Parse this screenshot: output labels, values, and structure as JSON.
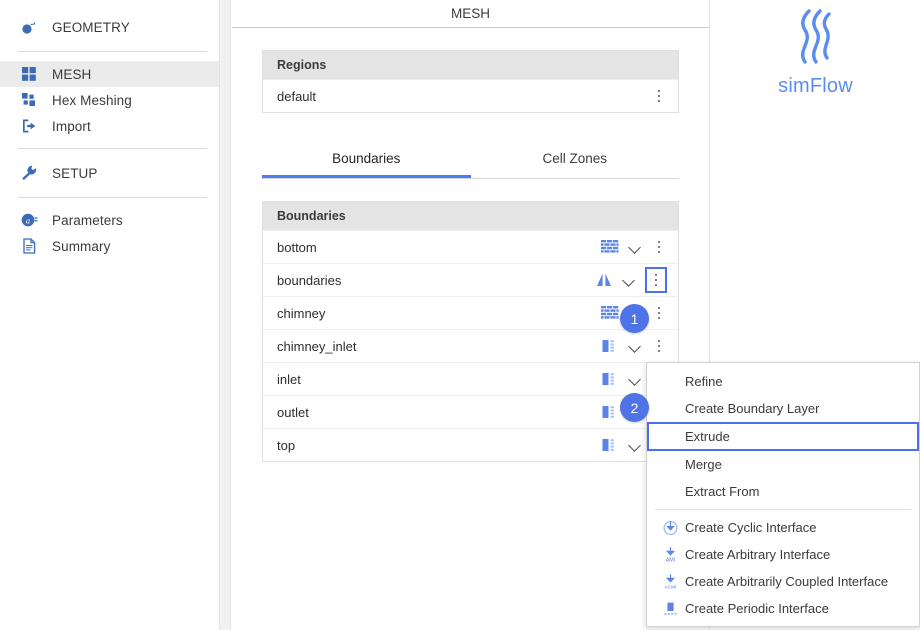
{
  "sidebar": {
    "groups": [
      {
        "items": [
          {
            "label": "GEOMETRY",
            "icon": "geometry-icon",
            "active": false
          }
        ]
      },
      {
        "items": [
          {
            "label": "MESH",
            "icon": "mesh-grid-icon",
            "active": true
          },
          {
            "label": "Hex Meshing",
            "icon": "hex-meshing-icon",
            "active": false
          },
          {
            "label": "Import",
            "icon": "import-icon",
            "active": false
          }
        ]
      },
      {
        "items": [
          {
            "label": "SETUP",
            "icon": "wrench-icon",
            "active": false
          }
        ]
      },
      {
        "items": [
          {
            "label": "Parameters",
            "icon": "parameters-icon",
            "active": false
          },
          {
            "label": "Summary",
            "icon": "summary-document-icon",
            "active": false
          }
        ]
      }
    ]
  },
  "main": {
    "title": "MESH",
    "regions": {
      "header": "Regions",
      "rows": [
        {
          "name": "default"
        }
      ]
    },
    "tabs": [
      {
        "label": "Boundaries",
        "active": true
      },
      {
        "label": "Cell Zones",
        "active": false
      }
    ],
    "boundaries": {
      "header": "Boundaries",
      "rows": [
        {
          "name": "bottom",
          "type_icon": "wall-brick-icon",
          "has_chevron": true,
          "kebab_selected": false
        },
        {
          "name": "boundaries",
          "type_icon": "symmetry-icon",
          "has_chevron": true,
          "kebab_selected": true
        },
        {
          "name": "chimney",
          "type_icon": "wall-brick-icon",
          "has_chevron": true,
          "kebab_selected": false
        },
        {
          "name": "chimney_inlet",
          "type_icon": "patch-icon",
          "has_chevron": true,
          "kebab_selected": false
        },
        {
          "name": "inlet",
          "type_icon": "patch-icon",
          "has_chevron": true,
          "kebab_selected": false
        },
        {
          "name": "outlet",
          "type_icon": "patch-icon",
          "has_chevron": true,
          "kebab_selected": false
        },
        {
          "name": "top",
          "type_icon": "patch-icon",
          "has_chevron": true,
          "kebab_selected": false
        }
      ]
    }
  },
  "right_panel": {
    "logo_text": "simFlow",
    "logo_icon": "simflow-flame-icon"
  },
  "context_menu": {
    "items": [
      {
        "label": "Refine",
        "icon": null,
        "selected": false
      },
      {
        "label": "Create Boundary Layer",
        "icon": null,
        "selected": false
      },
      {
        "label": "Extrude",
        "icon": null,
        "selected": true
      },
      {
        "label": "Merge",
        "icon": null,
        "selected": false
      },
      {
        "label": "Extract From",
        "icon": null,
        "selected": false
      },
      {
        "separator": true
      },
      {
        "label": "Create Cyclic Interface",
        "icon": "cyclic-interface-icon",
        "selected": false
      },
      {
        "label": "Create Arbitrary Interface",
        "icon": "ami-interface-icon",
        "selected": false
      },
      {
        "label": "Create Arbitrarily Coupled Interface",
        "icon": "acmi-interface-icon",
        "selected": false
      },
      {
        "label": "Create Periodic Interface",
        "icon": "periodic-interface-icon",
        "selected": false
      }
    ]
  },
  "step_badges": [
    {
      "number": "1"
    },
    {
      "number": "2"
    }
  ],
  "colors": {
    "accent_blue": "#4a6ef5",
    "badge_blue": "#4e74e8",
    "tab_underline": "#4c7cf0",
    "icon_blue": "#3b6bb5",
    "logo_blue": "#5b8df0",
    "card_header_gray": "#e4e4e4",
    "active_row_gray": "#ebebeb"
  }
}
